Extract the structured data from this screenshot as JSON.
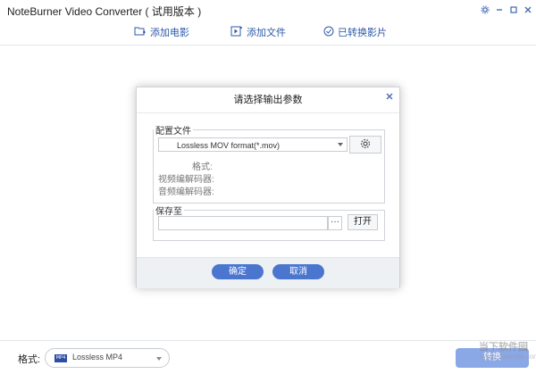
{
  "window": {
    "title": "NoteBurner Video Converter ( 试用版本 )",
    "controls": [
      "gear-icon",
      "minimize-icon",
      "maximize-icon",
      "close-icon"
    ]
  },
  "toolbar": {
    "add_movie": "添加电影",
    "add_file": "添加文件",
    "converted": "已转换影片"
  },
  "dialog": {
    "title": "请选择输出参数",
    "profile_group": "配置文件",
    "profile_value": "Lossless MOV format(*.mov)",
    "format_label": "格式:",
    "video_codec_label": "视频编解码器:",
    "audio_codec_label": "音频编解码器:",
    "save_group": "保存至",
    "save_path": "",
    "browse_label": "···",
    "open_label": "打开",
    "ok_label": "确定",
    "cancel_label": "取消"
  },
  "bottom": {
    "format_label": "格式:",
    "format_value": "Lossless MP4",
    "format_icon_text": "MP4",
    "convert_label": "转换"
  },
  "watermark": {
    "text": "当下软件园",
    "url": "www.downxia.com"
  },
  "colors": {
    "accent": "#4a76cf",
    "toolbar_text": "#2d5aa8",
    "convert_disabled": "#8aa7e6"
  }
}
